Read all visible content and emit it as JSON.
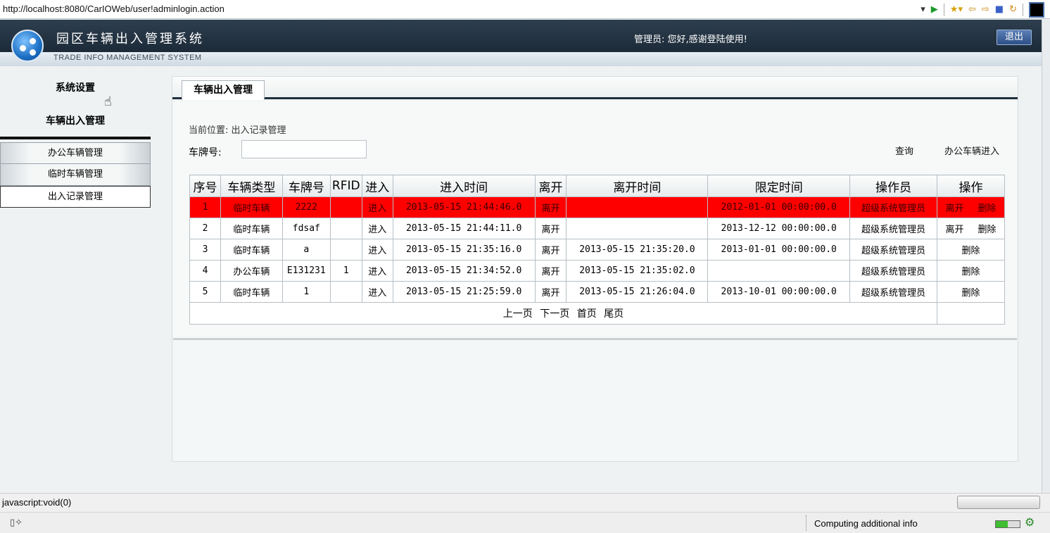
{
  "browser": {
    "url": "http://localhost:8080/CarIOWeb/user!adminlogin.action",
    "icons": [
      "dropdown-icon",
      "go-icon",
      "favorites-icon",
      "back-icon",
      "forward-icon",
      "stop-icon",
      "refresh-icon",
      "tile-icon"
    ]
  },
  "header": {
    "title": "园区车辆出入管理系统",
    "subtitle": "TRADE INFO MANAGEMENT SYSTEM",
    "welcome": "管理员:  您好,感谢登陆使用!",
    "logout_label": "退出"
  },
  "nav": {
    "section1": "系统设置",
    "section2": "车辆出入管理",
    "items": [
      {
        "label": "办公车辆管理"
      },
      {
        "label": "临时车辆管理"
      },
      {
        "label": "出入记录管理"
      }
    ]
  },
  "panel": {
    "tab_label": "车辆出入管理",
    "breadcrumb": "当前位置: 出入记录管理",
    "plate_label": "车牌号:",
    "plate_value": "",
    "query_label": "查询",
    "office_enter_label": "办公车辆进入"
  },
  "table": {
    "headers": [
      "序号",
      "车辆类型",
      "车牌号",
      "RFID",
      "进入",
      "进入时间",
      "离开",
      "离开时间",
      "限定时间",
      "操作员",
      "操作"
    ],
    "rows": [
      {
        "no": "1",
        "type": "临时车辆",
        "plate": "2222",
        "rfid": "",
        "enter": "进入",
        "enter_time": "2013-05-15 21:44:46.0",
        "leave": "离开",
        "leave_time": "",
        "limit_time": "2012-01-01 00:00:00.0",
        "operator": "超级系统管理员",
        "leave_action": "离开",
        "delete_action": "删除",
        "highlight": true
      },
      {
        "no": "2",
        "type": "临时车辆",
        "plate": "fdsaf",
        "rfid": "",
        "enter": "进入",
        "enter_time": "2013-05-15 21:44:11.0",
        "leave": "离开",
        "leave_time": "",
        "limit_time": "2013-12-12 00:00:00.0",
        "operator": "超级系统管理员",
        "leave_action": "离开",
        "delete_action": "删除"
      },
      {
        "no": "3",
        "type": "临时车辆",
        "plate": "a",
        "rfid": "",
        "enter": "进入",
        "enter_time": "2013-05-15 21:35:16.0",
        "leave": "离开",
        "leave_time": "2013-05-15 21:35:20.0",
        "limit_time": "2013-01-01 00:00:00.0",
        "operator": "超级系统管理员",
        "leave_action": "",
        "delete_action": "删除"
      },
      {
        "no": "4",
        "type": "办公车辆",
        "plate": "E131231",
        "rfid": "1",
        "enter": "进入",
        "enter_time": "2013-05-15 21:34:52.0",
        "leave": "离开",
        "leave_time": "2013-05-15 21:35:02.0",
        "limit_time": "",
        "operator": "超级系统管理员",
        "leave_action": "",
        "delete_action": "删除"
      },
      {
        "no": "5",
        "type": "临时车辆",
        "plate": "1",
        "rfid": "",
        "enter": "进入",
        "enter_time": "2013-05-15 21:25:59.0",
        "leave": "离开",
        "leave_time": "2013-05-15 21:26:04.0",
        "limit_time": "2013-10-01 00:00:00.0",
        "operator": "超级系统管理员",
        "leave_action": "",
        "delete_action": "删除"
      }
    ],
    "pager": {
      "prev": "上一页",
      "next": "下一页",
      "first": "首页",
      "last": "尾页"
    }
  },
  "status": {
    "link_text": "javascript:void(0)",
    "info": "Computing additional info"
  },
  "colors": {
    "highlight_row": "#ff0000",
    "header_bg": "#1c2a38",
    "logout_bg": "#2d4f86"
  }
}
